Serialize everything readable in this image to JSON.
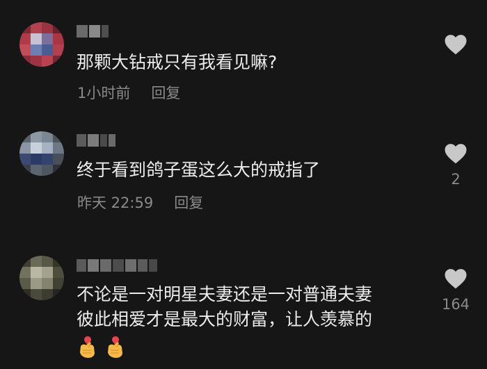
{
  "comments": [
    {
      "text": "那颗大钻戒只有我看见嘛?",
      "time": "1小时前",
      "reply_label": "回复",
      "like_count": ""
    },
    {
      "text": "终于看到鸽子蛋这么大的戒指了",
      "time": "昨天 22:59",
      "reply_label": "回复",
      "like_count": "2"
    },
    {
      "text_line1": "不论是一对明星夫妻还是一对普通夫妻",
      "text_line2": "彼此相爱才是最大的财富，让人羡慕的",
      "emojis": [
        "finger-heart-emoji",
        "finger-heart-emoji"
      ],
      "like_count": "164"
    }
  ],
  "colors": {
    "background": "#161616",
    "text": "#ececec",
    "secondary": "#8a8a8a",
    "heart": "#c8c8c8"
  },
  "icons": [
    "heart-icon",
    "finger-heart-emoji"
  ]
}
